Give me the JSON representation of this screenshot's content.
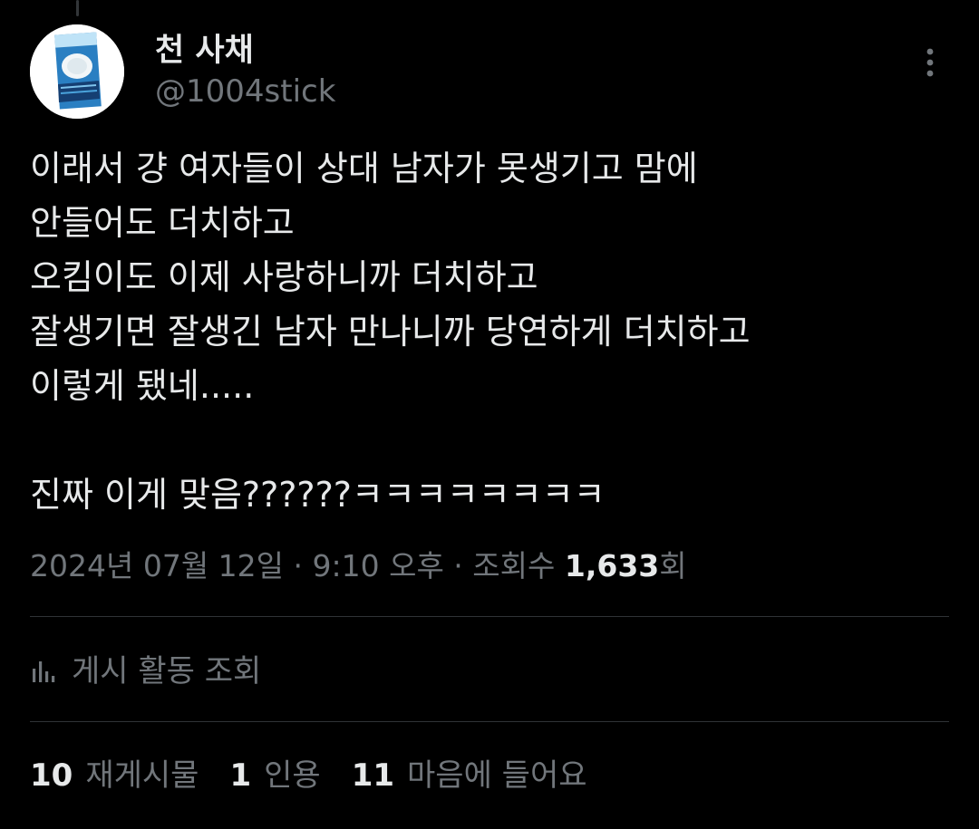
{
  "author": {
    "name": "천 사채",
    "handle": "@1004stick"
  },
  "post": {
    "lines": [
      "이래서 걍 여자들이 상대 남자가 못생기고 맘에",
      "안들어도 더치하고",
      "오킴이도 이제 사랑하니까 더치하고",
      "잘생기면 잘생긴 남자 만나니까 당연하게 더치하고",
      "이렇게 됐네.....",
      "",
      "진짜 이게 맞음??????ㅋㅋㅋㅋㅋㅋㅋㅋ"
    ]
  },
  "meta": {
    "timestamp": "2024년 07월 12일 · 9:10 오후 · 조회수 ",
    "views": "1,633",
    "views_suffix": "회"
  },
  "activity": {
    "label": "게시 활동 조회",
    "icon": "bar-chart-icon"
  },
  "stats": {
    "reposts_count": "10",
    "reposts_label": "재게시물",
    "quotes_count": "1",
    "quotes_label": "인용",
    "likes_count": "11",
    "likes_label": "마음에 들어요"
  },
  "colors": {
    "background": "#000000",
    "text": "#e7e9ea",
    "secondary": "#71767b",
    "divider": "#2f3336"
  }
}
